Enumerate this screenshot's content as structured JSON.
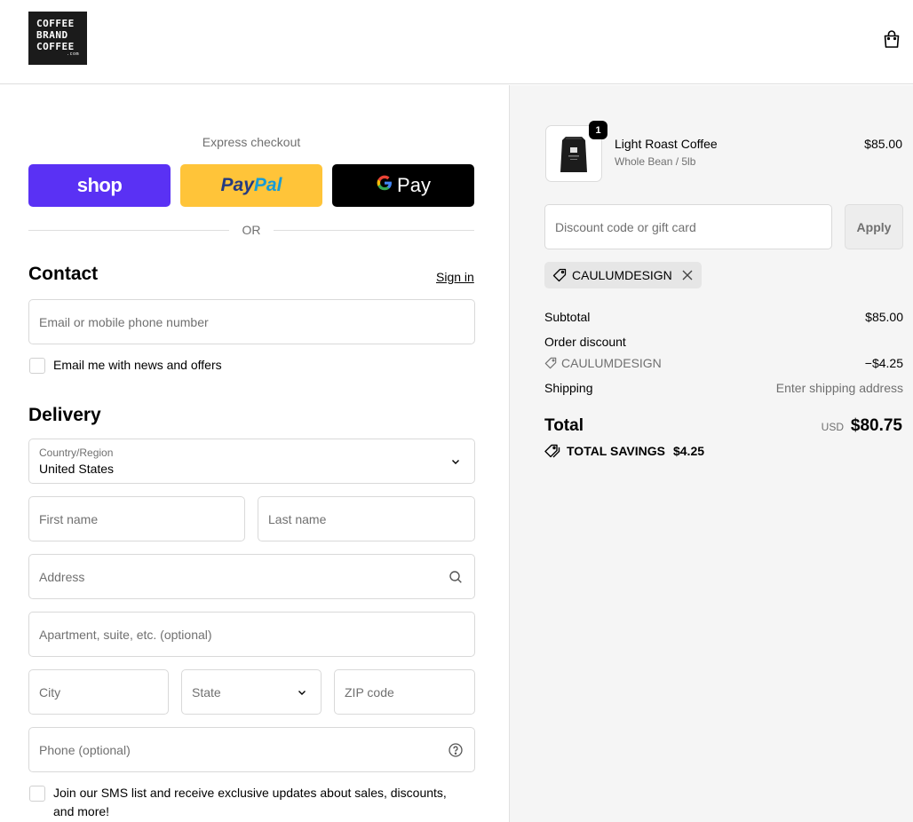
{
  "header": {
    "logo_lines": [
      "COFFEE",
      "BRAND",
      "COFFEE"
    ],
    "logo_suffix": ".com"
  },
  "express": {
    "title": "Express checkout",
    "shop_label": "shop",
    "paypal_part1": "Pay",
    "paypal_part2": "Pal",
    "gpay_g": "G",
    "gpay_label": "Pay",
    "or_label": "OR"
  },
  "contact": {
    "heading": "Contact",
    "signin_label": "Sign in",
    "email_placeholder": "Email or mobile phone number",
    "news_label": "Email me with news and offers"
  },
  "delivery": {
    "heading": "Delivery",
    "country_label": "Country/Region",
    "country_value": "United States",
    "first_name": "First name",
    "last_name": "Last name",
    "address": "Address",
    "apartment": "Apartment, suite, etc. (optional)",
    "city": "City",
    "state": "State",
    "zip": "ZIP code",
    "phone": "Phone (optional)",
    "sms_label": "Join our SMS list and receive exclusive updates about sales, discounts, and more!"
  },
  "summary": {
    "item": {
      "quantity": "1",
      "name": "Light Roast Coffee",
      "variant": "Whole Bean / 5lb",
      "price": "$85.00"
    },
    "discount_placeholder": "Discount code or gift card",
    "apply_label": "Apply",
    "applied_code": "CAULUMDESIGN",
    "subtotal_label": "Subtotal",
    "subtotal_value": "$85.00",
    "order_discount_label": "Order discount",
    "discount_code": "CAULUMDESIGN",
    "discount_value": "−$4.25",
    "shipping_label": "Shipping",
    "shipping_value": "Enter shipping address",
    "total_label": "Total",
    "currency": "USD",
    "total_value": "$80.75",
    "savings_label": "TOTAL SAVINGS",
    "savings_value": "$4.25"
  },
  "colors": {
    "shop": "#5a31f4",
    "paypal": "#ffc439",
    "gpay": "#000000",
    "summary_bg": "#f5f5f5"
  }
}
